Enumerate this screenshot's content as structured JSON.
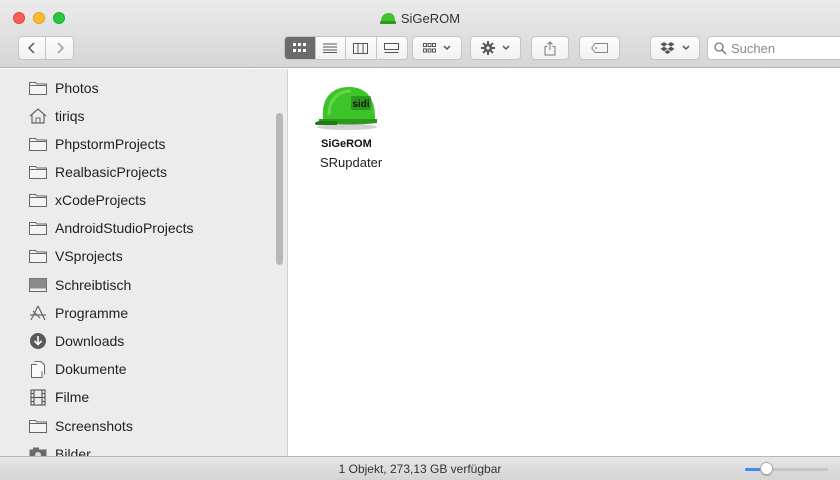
{
  "window": {
    "title": "SiGeROM"
  },
  "toolbar": {
    "search_placeholder": "Suchen"
  },
  "sidebar": {
    "items": [
      {
        "label": "Photos",
        "icon": "folder-icon"
      },
      {
        "label": "tiriqs",
        "icon": "home-icon"
      },
      {
        "label": "PhpstormProjects",
        "icon": "folder-icon"
      },
      {
        "label": "RealbasicProjects",
        "icon": "folder-icon"
      },
      {
        "label": "xCodeProjects",
        "icon": "folder-icon"
      },
      {
        "label": "AndroidStudioProjects",
        "icon": "folder-icon"
      },
      {
        "label": "VSprojects",
        "icon": "folder-icon"
      },
      {
        "label": "Schreibtisch",
        "icon": "desktop-icon"
      },
      {
        "label": "Programme",
        "icon": "applications-icon"
      },
      {
        "label": "Downloads",
        "icon": "downloads-icon"
      },
      {
        "label": "Dokumente",
        "icon": "documents-icon"
      },
      {
        "label": "Filme",
        "icon": "movies-icon"
      },
      {
        "label": "Screenshots",
        "icon": "folder-icon"
      },
      {
        "label": "Bilder",
        "icon": "pictures-icon"
      }
    ]
  },
  "main": {
    "item": {
      "icon_label": "SiGeROM",
      "helmet_text": "sidi",
      "name": "SRupdater"
    }
  },
  "statusbar": {
    "text": "1 Objekt, 273,13 GB verfügbar",
    "zoom_level": 0.25
  },
  "colors": {
    "accent": "#3b8cf5",
    "helmet_green": "#3fc32a"
  }
}
